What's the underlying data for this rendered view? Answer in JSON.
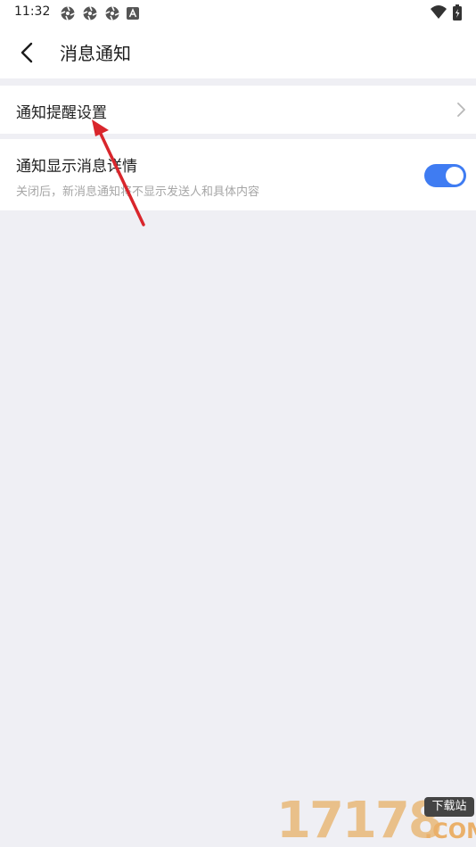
{
  "status_bar": {
    "time": "11:32",
    "icons": [
      "notification-icon",
      "notification-icon",
      "notification-icon",
      "a-icon"
    ],
    "right_icons": [
      "wifi-icon",
      "battery-icon"
    ]
  },
  "nav": {
    "title": "消息通知",
    "back_icon": "back-arrow-icon"
  },
  "settings": {
    "reminder": {
      "label": "通知提醒设置",
      "icon": "chevron-right-icon"
    },
    "show_details": {
      "label": "通知显示消息详情",
      "description": "关闭后，新消息通知将不显示发送人和具体内容",
      "enabled": true
    }
  },
  "colors": {
    "accent": "#3f7cf2",
    "background": "#efeff4",
    "annotation_arrow": "#d9262c"
  },
  "watermark": {
    "number": "17178",
    "badge": "下载站",
    "domain": ".COM"
  }
}
